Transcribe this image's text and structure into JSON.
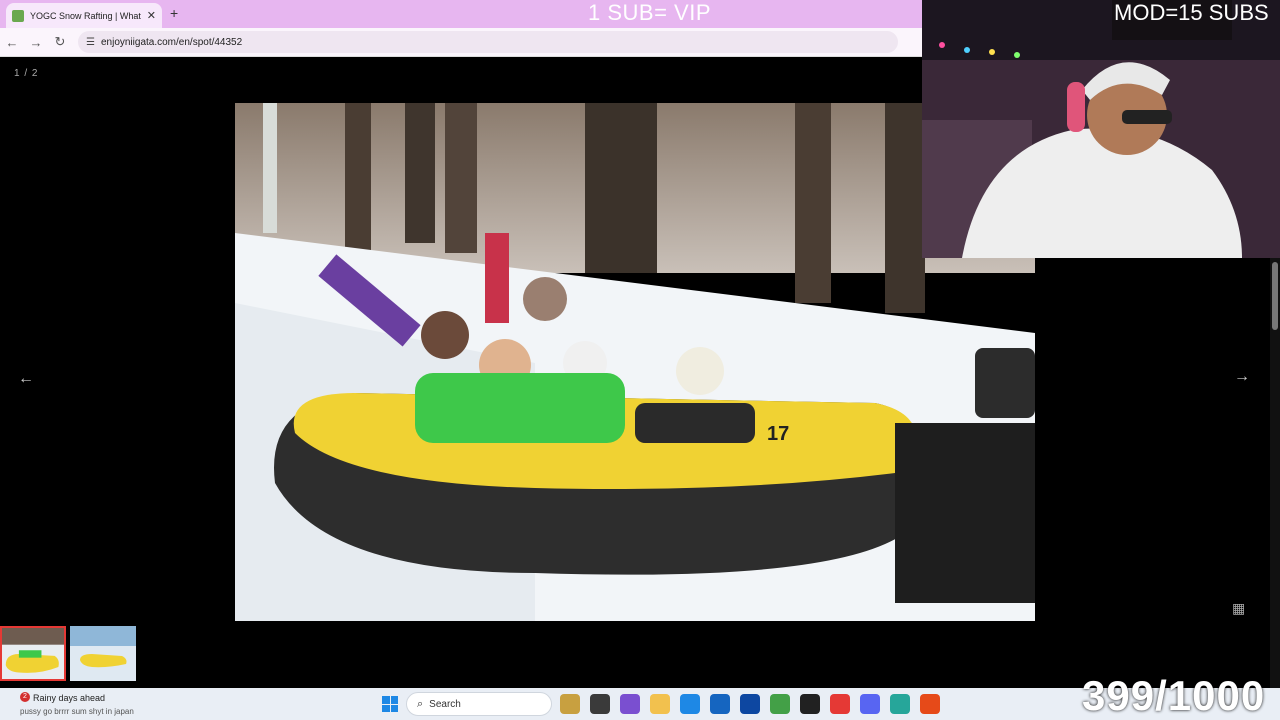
{
  "browser": {
    "tab_title": "YOGC Snow Rafting | What to Do in Niigata",
    "new_tab_label": "+",
    "url": "enjoyniigata.com/en/spot/44352"
  },
  "stream_overlays": {
    "sub_vip": "1 SUB= VIP",
    "mod_subs": "MOD=15 SUBS",
    "progress_counter": "399/1000"
  },
  "gallery": {
    "counter": "1 / 2",
    "thumbnails": [
      {
        "state": "active"
      },
      {
        "state": "inactive"
      }
    ]
  },
  "taskbar": {
    "notification_count": "2",
    "notification_title": "Rainy days ahead",
    "ticker_text": "pussy go brrrr sum shyt in japan",
    "search_placeholder": "Search"
  },
  "colors": {
    "tabbar": "#e7b6f0",
    "raft_yellow": "#f0d233",
    "taskbar": "#e9eef5"
  }
}
